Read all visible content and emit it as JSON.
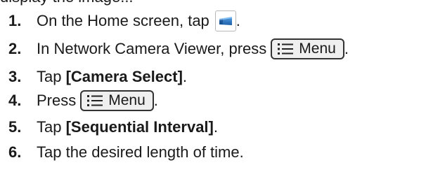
{
  "intro_fragment": "display the image...",
  "steps": [
    {
      "number": "1.",
      "text_before": "On the Home screen, tap",
      "text_after": "."
    },
    {
      "number": "2.",
      "text_before": "In Network Camera Viewer, press",
      "text_after": "."
    },
    {
      "number": "3.",
      "text_before": "Tap ",
      "bold": "[Camera Select]",
      "text_after": "."
    },
    {
      "number": "4.",
      "text_before": "Press",
      "text_after": "."
    },
    {
      "number": "5.",
      "text_before": "Tap ",
      "bold": "[Sequential Interval]",
      "text_after": "."
    },
    {
      "number": "6.",
      "text": "Tap the desired length of time."
    }
  ],
  "menu_button_label": "Menu",
  "icons": {
    "app": "network-camera-viewer-app-icon",
    "menu": "list-menu-icon"
  }
}
